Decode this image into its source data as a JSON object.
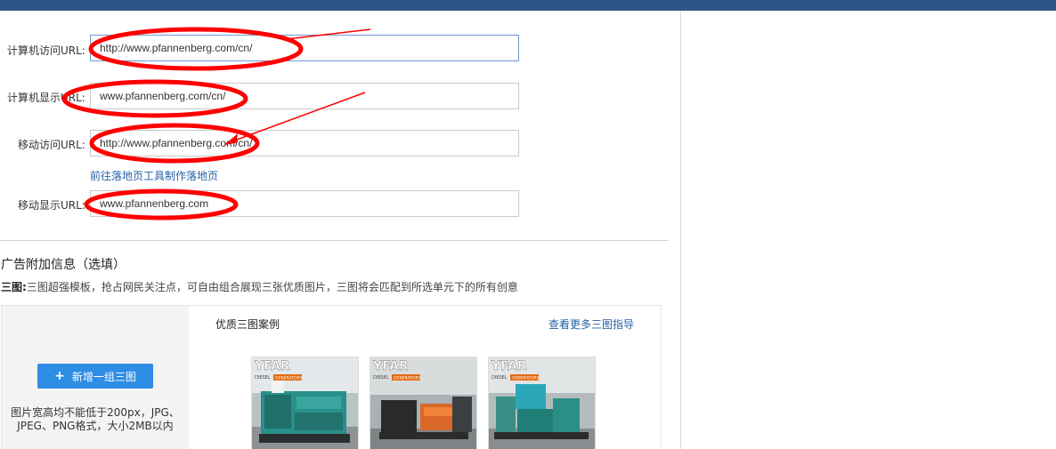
{
  "form": {
    "fields": [
      {
        "label": "计算机访问URL:",
        "value": "http://www.pfannenberg.com/cn/"
      },
      {
        "label": "计算机显示URL:",
        "value": "www.pfannenberg.com/cn/"
      },
      {
        "label": "移动访问URL:",
        "value": "http://www.pfannenberg.com/cn/"
      },
      {
        "label": "移动显示URL:",
        "value": "www.pfannenberg.com"
      }
    ],
    "landing_link": "前往落地页工具制作落地页"
  },
  "extra": {
    "title": "广告附加信息（选填）",
    "desc_prefix": "三图:",
    "desc": "三图超强模板，抢占网民关注点，可自由组合展现三张优质图片，三图将会匹配到所选单元下的所有创意"
  },
  "three_image": {
    "add_button": "新增一组三图",
    "hint_line1": "图片宽高均不能低于200px，JPG、",
    "hint_line2": "JPEG、PNG格式，大小2MB以内",
    "case_title": "优质三图案例",
    "more_link": "查看更多三图指导",
    "thumbnails": [
      {
        "logo": "YFAR",
        "sub": "DIESEL",
        "badge": "GENERATORS"
      },
      {
        "logo": "YFAR",
        "sub": "DIESEL",
        "badge": "GENERATORS"
      },
      {
        "logo": "YFAR",
        "sub": "DIESEL",
        "badge": "GENERATORS"
      }
    ]
  },
  "colors": {
    "topbar": "#2f5488",
    "link": "#2361a5",
    "button": "#2e8de5",
    "annotation": "#ff0000"
  }
}
